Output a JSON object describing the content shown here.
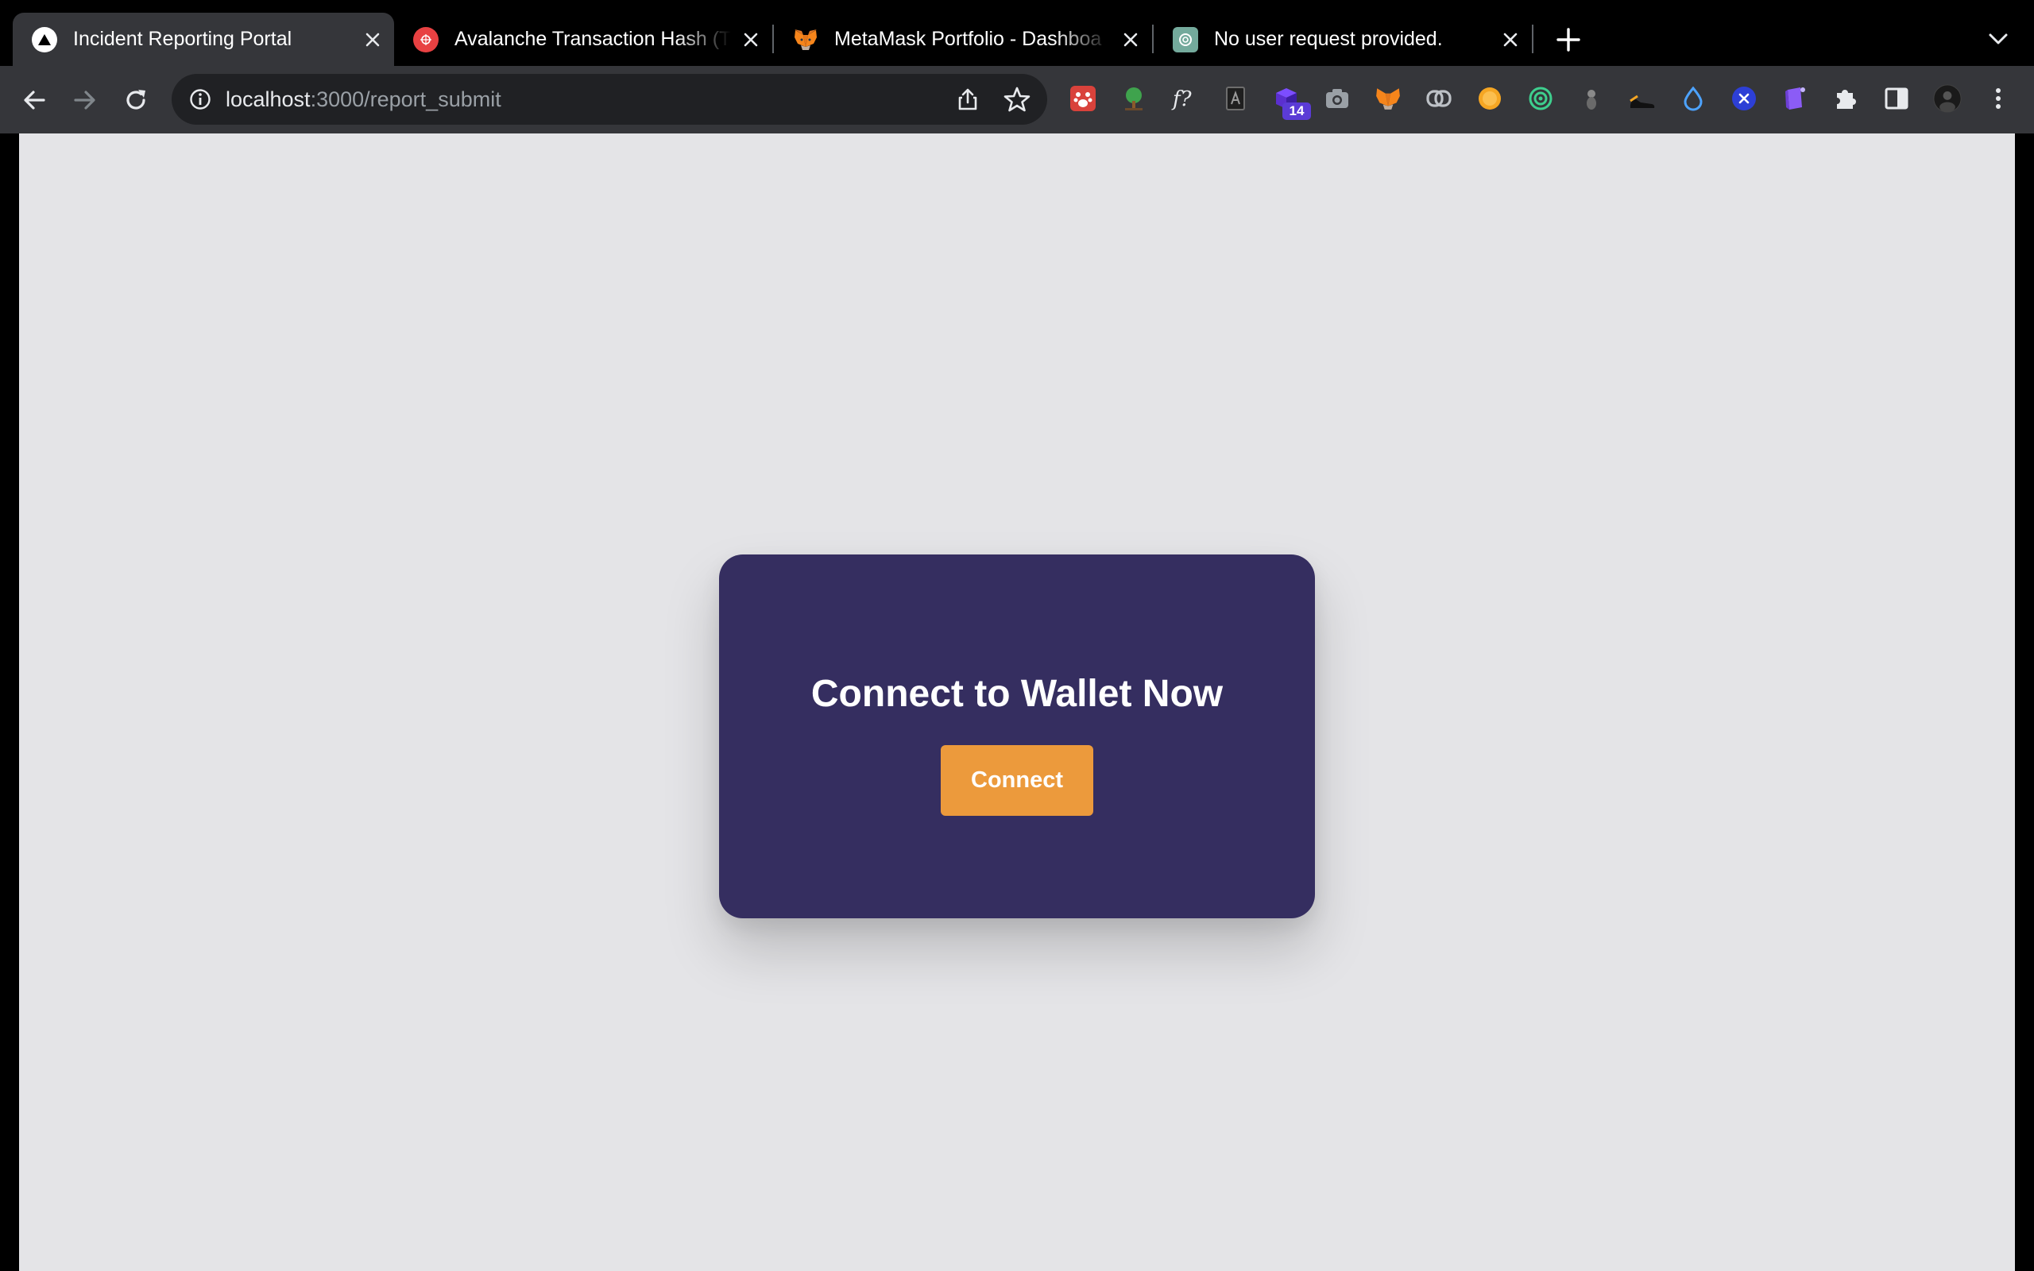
{
  "browser": {
    "tabs": [
      {
        "title": "Incident Reporting Portal",
        "active": true,
        "favicon": "triangle-icon"
      },
      {
        "title": "Avalanche Transaction Hash (T",
        "active": false,
        "favicon": "avalanche-icon"
      },
      {
        "title": "MetaMask Portfolio - Dashboa",
        "active": false,
        "favicon": "metamask-fox-icon"
      },
      {
        "title": "No user request provided.",
        "active": false,
        "favicon": "openai-icon"
      }
    ],
    "address_bar": {
      "host": "localhost",
      "path": ":3000/report_submit"
    },
    "extensions_badge": "14",
    "colors": {
      "tabstrip": "#000000",
      "toolbar": "#35363a",
      "omnibox": "#202124"
    }
  },
  "page": {
    "background": "#e4e4e7",
    "card": {
      "heading": "Connect to Wallet Now",
      "button_label": "Connect",
      "card_color": "#352e60",
      "button_color": "#ec9a3c"
    }
  }
}
